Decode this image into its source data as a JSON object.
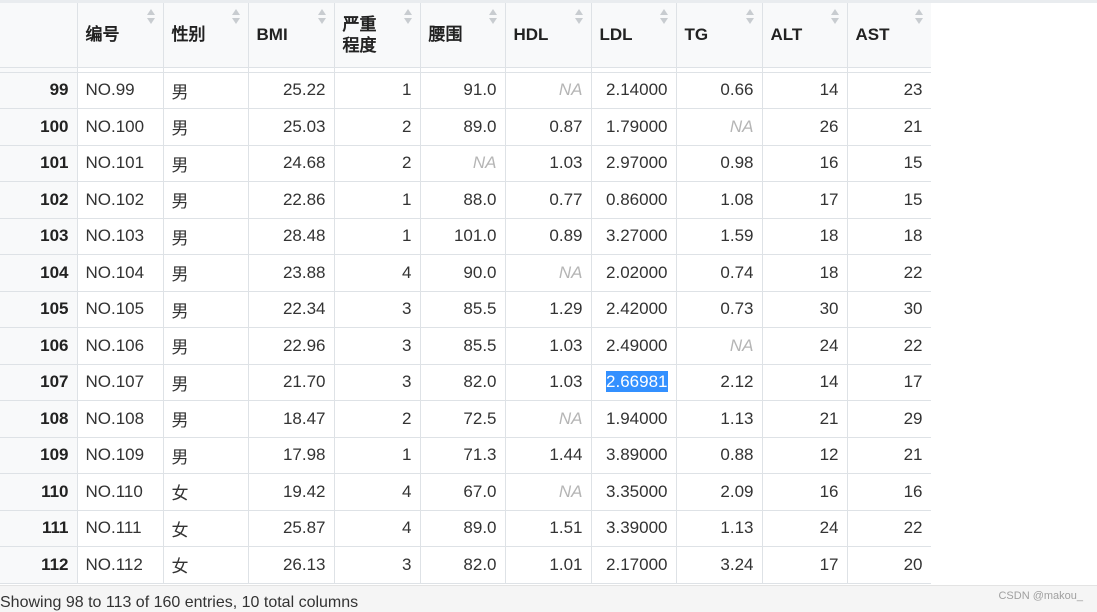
{
  "columns": [
    {
      "label": ""
    },
    {
      "label": "编号"
    },
    {
      "label": "性别"
    },
    {
      "label": "BMI"
    },
    {
      "label": "严重\n程度"
    },
    {
      "label": "腰围"
    },
    {
      "label": "HDL"
    },
    {
      "label": "LDL"
    },
    {
      "label": "TG"
    },
    {
      "label": "ALT"
    },
    {
      "label": "AST"
    }
  ],
  "column_align": [
    "idx",
    "txt",
    "txt",
    "num",
    "num",
    "num",
    "num",
    "num",
    "num",
    "num",
    "num"
  ],
  "rows": [
    [
      "99",
      "NO.99",
      "男",
      "25.22",
      "1",
      "91.0",
      "NA",
      "2.14000",
      "0.66",
      "14",
      "23"
    ],
    [
      "100",
      "NO.100",
      "男",
      "25.03",
      "2",
      "89.0",
      "0.87",
      "1.79000",
      "NA",
      "26",
      "21"
    ],
    [
      "101",
      "NO.101",
      "男",
      "24.68",
      "2",
      "NA",
      "1.03",
      "2.97000",
      "0.98",
      "16",
      "15"
    ],
    [
      "102",
      "NO.102",
      "男",
      "22.86",
      "1",
      "88.0",
      "0.77",
      "0.86000",
      "1.08",
      "17",
      "15"
    ],
    [
      "103",
      "NO.103",
      "男",
      "28.48",
      "1",
      "101.0",
      "0.89",
      "3.27000",
      "1.59",
      "18",
      "18"
    ],
    [
      "104",
      "NO.104",
      "男",
      "23.88",
      "4",
      "90.0",
      "NA",
      "2.02000",
      "0.74",
      "18",
      "22"
    ],
    [
      "105",
      "NO.105",
      "男",
      "22.34",
      "3",
      "85.5",
      "1.29",
      "2.42000",
      "0.73",
      "30",
      "30"
    ],
    [
      "106",
      "NO.106",
      "男",
      "22.96",
      "3",
      "85.5",
      "1.03",
      "2.49000",
      "NA",
      "24",
      "22"
    ],
    [
      "107",
      "NO.107",
      "男",
      "21.70",
      "3",
      "82.0",
      "1.03",
      "2.66981",
      "2.12",
      "14",
      "17"
    ],
    [
      "108",
      "NO.108",
      "男",
      "18.47",
      "2",
      "72.5",
      "NA",
      "1.94000",
      "1.13",
      "21",
      "29"
    ],
    [
      "109",
      "NO.109",
      "男",
      "17.98",
      "1",
      "71.3",
      "1.44",
      "3.89000",
      "0.88",
      "12",
      "21"
    ],
    [
      "110",
      "NO.110",
      "女",
      "19.42",
      "4",
      "67.0",
      "NA",
      "3.35000",
      "2.09",
      "16",
      "16"
    ],
    [
      "111",
      "NO.111",
      "女",
      "25.87",
      "4",
      "89.0",
      "1.51",
      "3.39000",
      "1.13",
      "24",
      "22"
    ],
    [
      "112",
      "NO.112",
      "女",
      "26.13",
      "3",
      "82.0",
      "1.01",
      "2.17000",
      "3.24",
      "17",
      "20"
    ]
  ],
  "selected_cell": {
    "row": 8,
    "col": 7
  },
  "status": {
    "text": "Showing 98 to 113 of 160 entries, 10 total columns"
  },
  "watermark": {
    "text": "CSDN @makou_"
  },
  "colors": {
    "selection": "#3390ff",
    "na_text": "#b5b5b5",
    "header_bg": "#f8f9fa",
    "border": "#dee2e6"
  }
}
